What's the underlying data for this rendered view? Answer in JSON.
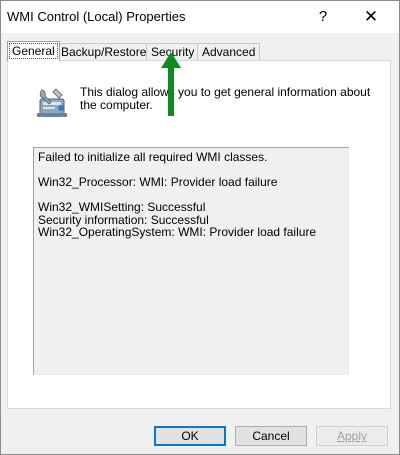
{
  "window": {
    "title": "WMI Control (Local) Properties",
    "help_glyph": "?",
    "close_glyph": "✕"
  },
  "tabs": [
    {
      "label": "General",
      "active": true
    },
    {
      "label": "Backup/Restore",
      "active": false
    },
    {
      "label": "Security",
      "active": false
    },
    {
      "label": "Advanced",
      "active": false
    }
  ],
  "general": {
    "description": "This dialog allows you to get general information about the computer.",
    "icon": "computer-management-tools-icon",
    "info_lines": [
      "Failed to initialize all required WMI classes.",
      "",
      "Win32_Processor: WMI: Provider load failure",
      "",
      "Win32_WMISetting: Successful",
      "Security information: Successful",
      "Win32_OperatingSystem: WMI: Provider load failure"
    ]
  },
  "buttons": {
    "ok": "OK",
    "cancel": "Cancel",
    "apply": "Apply"
  },
  "annotation": {
    "icon": "green-up-arrow",
    "color": "#108a1e"
  }
}
